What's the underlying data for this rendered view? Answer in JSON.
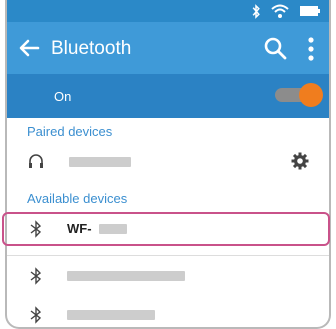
{
  "app_bar": {
    "title": "Bluetooth"
  },
  "toggle_bar": {
    "label": "On",
    "bluetooth_enabled": true
  },
  "paired_section": {
    "header": "Paired devices",
    "devices": [
      {
        "name_redacted": true,
        "icon": "headphones-icon",
        "has_settings": true
      }
    ]
  },
  "available_section": {
    "header": "Available devices",
    "devices": [
      {
        "name_visible": "WF-",
        "name_redacted": true,
        "icon": "bluetooth-icon",
        "highlighted": true
      },
      {
        "name_redacted": true,
        "icon": "bluetooth-icon"
      },
      {
        "name_redacted": true,
        "icon": "bluetooth-icon"
      }
    ]
  },
  "colors": {
    "status_bar": "#2b89c8",
    "app_bar": "#3f9ad8",
    "toggle_bar": "#2b82c4",
    "accent_orange": "#f07d1e",
    "section_header": "#3b8fd0",
    "highlight": "#c9528a"
  }
}
